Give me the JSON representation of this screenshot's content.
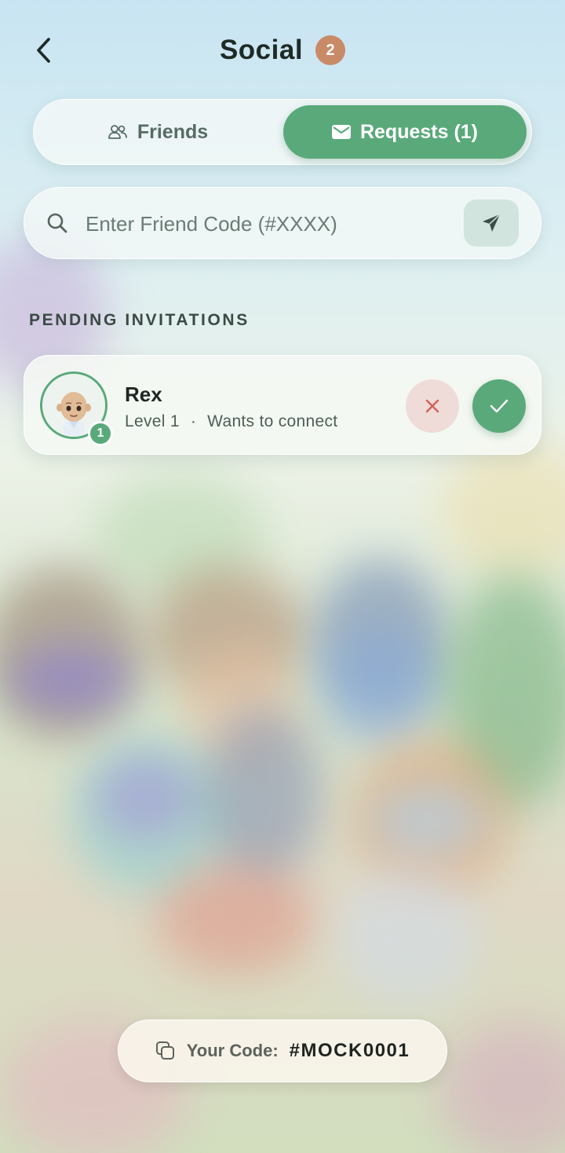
{
  "header": {
    "title": "Social",
    "badge_count": "2"
  },
  "tabs": [
    {
      "label": "Friends",
      "icon": "people-icon",
      "active": false
    },
    {
      "label": "Requests (1)",
      "icon": "envelope-icon",
      "active": true
    }
  ],
  "search": {
    "placeholder": "Enter Friend Code (#XXXX)",
    "value": ""
  },
  "pending": {
    "section_label": "PENDING INVITATIONS",
    "items": [
      {
        "name": "Rex",
        "level_text": "Level 1",
        "separator": "·",
        "status_text": "Wants to connect",
        "level_badge": "1"
      }
    ]
  },
  "footer": {
    "code_label": "Your Code:",
    "code_value": "#MOCK0001"
  },
  "colors": {
    "accent_green": "#5aa97a",
    "badge_orange": "#c98a68",
    "decline_bg": "#efdcd8",
    "decline_x": "#d4605a"
  }
}
